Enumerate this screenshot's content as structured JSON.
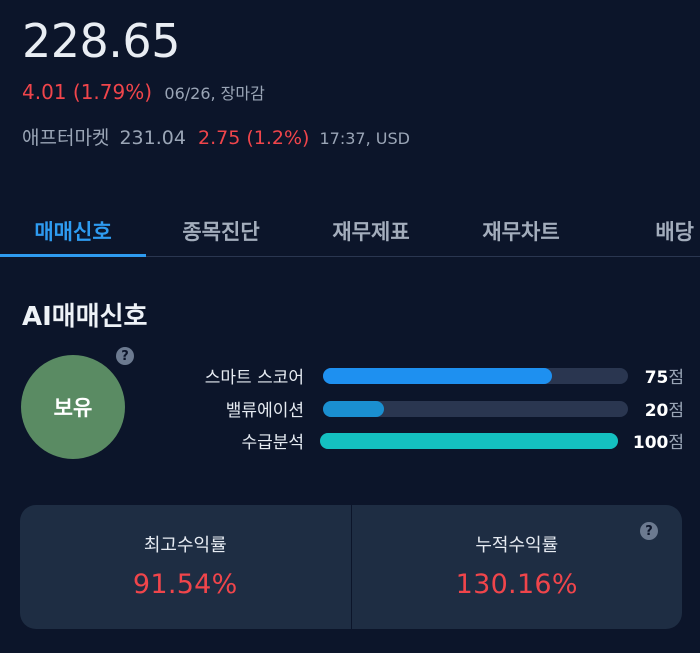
{
  "quote": {
    "price": "228.65",
    "change": "4.01 (1.79%)",
    "change_meta": "06/26, 장마감",
    "after_label": "애프터마켓",
    "after_price": "231.04",
    "after_change": "2.75 (1.2%)",
    "after_meta": "17:37, USD"
  },
  "tabs": [
    {
      "label": "매매신호",
      "active": true
    },
    {
      "label": "종목진단"
    },
    {
      "label": "재무제표"
    },
    {
      "label": "재무차트"
    },
    {
      "label": "배당"
    }
  ],
  "ai": {
    "title": "AI매매신호",
    "signal": "보유",
    "help": "?",
    "scores": [
      {
        "label": "스마트 스코어",
        "value": 75,
        "unit": "점",
        "color": "#1e90f0"
      },
      {
        "label": "밸류에이션",
        "value": 20,
        "unit": "점",
        "color": "#1a8fd0"
      },
      {
        "label": "수급분석",
        "value": 100,
        "unit": "점",
        "color": "#14c0c0"
      }
    ]
  },
  "returns": {
    "max_label": "최고수익률",
    "max_value": "91.54%",
    "cum_label": "누적수익률",
    "cum_value": "130.16%",
    "help": "?"
  },
  "colors": {
    "background": "#0c152a",
    "accent": "#2e9bf0",
    "up": "#f0454b",
    "signal_hold": "#5a8b63",
    "card": "#1e2d43"
  }
}
